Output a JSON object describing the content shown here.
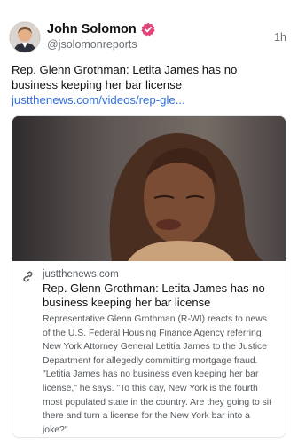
{
  "author": {
    "name": "John Solomon",
    "handle": "@jsolomonreports",
    "avatar_icon": "avatar-photo",
    "verified_icon": "verified-badge-icon",
    "verified_color": "#e0447a"
  },
  "post": {
    "time": "1h",
    "text": "Rep. Glenn Grothman: Letita James has no business keeping her bar license ",
    "link_text": "justthenews.com/videos/rep-gle...",
    "link_color": "#2f6fe0"
  },
  "card": {
    "image_icon": "news-photo-image",
    "link_icon": "chain-link-icon",
    "domain": "justthenews.com",
    "title": "Rep. Glenn Grothman: Letita James has no business keeping her bar license",
    "description": "Representative Glenn Grothman (R-WI) reacts to news of the U.S. Federal Housing Finance Agency referring New York Attorney General Letitia James to the Justice Department for allegedly committing mortgage fraud. \"Letitia James has no business even keeping her bar license,\" he says. \"To this day, New York is the fourth most populated state in the country. Are they going to sit there and turn a license for the New York bar into a joke?\""
  }
}
